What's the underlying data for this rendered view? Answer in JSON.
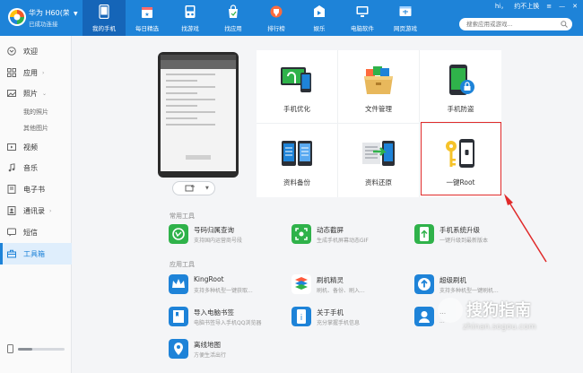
{
  "colors": {
    "accent": "#1e83d8",
    "accent_dark": "#1565b8",
    "highlight": "#e02a2a"
  },
  "device": {
    "name": "华为 H60(荣...",
    "status": "已成功连接"
  },
  "nav": [
    {
      "label": "我的手机",
      "icon": "phone-icon"
    },
    {
      "label": "每日精选",
      "icon": "calendar-icon"
    },
    {
      "label": "找游戏",
      "icon": "gamepad-icon"
    },
    {
      "label": "找应用",
      "icon": "shopping-bag-icon"
    },
    {
      "label": "排行榜",
      "icon": "trophy-icon"
    },
    {
      "label": "娱乐",
      "icon": "music-icon"
    },
    {
      "label": "电脑软件",
      "icon": "monitor-icon"
    },
    {
      "label": "网页游戏",
      "icon": "browser-icon"
    }
  ],
  "window": {
    "user": "hi，",
    "checkin": "约不上换",
    "search_placeholder": "搜索应用或游戏..."
  },
  "sidebar": {
    "items": [
      {
        "label": "欢迎",
        "icon": "welcome-icon"
      },
      {
        "label": "应用",
        "icon": "apps-grid-icon"
      },
      {
        "label": "照片",
        "icon": "photo-icon"
      },
      {
        "label": "视频",
        "icon": "video-icon"
      },
      {
        "label": "音乐",
        "icon": "music-note-icon"
      },
      {
        "label": "电子书",
        "icon": "book-icon"
      },
      {
        "label": "通讯录",
        "icon": "contacts-icon"
      },
      {
        "label": "短信",
        "icon": "sms-icon"
      },
      {
        "label": "工具箱",
        "icon": "toolbox-icon"
      }
    ],
    "photo_sub": [
      "我的照片",
      "其他图片"
    ],
    "storage_fraction": 0.3
  },
  "tiles": [
    {
      "label": "手机优化",
      "icon": "phone-optimize-icon"
    },
    {
      "label": "文件管理",
      "icon": "file-manage-icon"
    },
    {
      "label": "手机防盗",
      "icon": "anti-theft-icon"
    },
    {
      "label": "资料备份",
      "icon": "backup-icon"
    },
    {
      "label": "资料还原",
      "icon": "restore-icon"
    },
    {
      "label": "一键Root",
      "icon": "root-key-icon"
    }
  ],
  "sections": {
    "common": {
      "title": "常用工具",
      "tools": [
        {
          "name": "号码归属查询",
          "desc": "支持国内运营商号段",
          "color": "#2fb24a",
          "icon": "phone-lookup-icon"
        },
        {
          "name": "动态截屏",
          "desc": "生成手机屏幕动态GIF",
          "color": "#2fb24a",
          "icon": "screenshot-icon"
        },
        {
          "name": "手机系统升级",
          "desc": "一键升级到最新版本",
          "color": "#2fb24a",
          "icon": "system-upgrade-icon"
        }
      ]
    },
    "apps": {
      "title": "应用工具",
      "tools": [
        {
          "name": "KingRoot",
          "desc": "支持多种机型一键获取...",
          "color": "#1e83d8",
          "icon": "kingroot-icon"
        },
        {
          "name": "刷机精灵",
          "desc": "刷机、备份、刷入...",
          "color": "#1e83d8",
          "icon": "flash-tool-icon"
        },
        {
          "name": "超级刷机",
          "desc": "支持多种机型一键刷机...",
          "color": "#1e83d8",
          "icon": "super-flash-icon"
        },
        {
          "name": "导入电脑书签",
          "desc": "电脑书签导入手机QQ浏览器",
          "color": "#1e83d8",
          "icon": "bookmark-import-icon"
        },
        {
          "name": "关于手机",
          "desc": "充分掌握手机信息",
          "color": "#1e83d8",
          "icon": "phone-info-icon"
        },
        {
          "name": "...",
          "desc": "...",
          "color": "#1e83d8",
          "icon": "contacts-tool-icon"
        },
        {
          "name": "离线地图",
          "desc": "方便生活出行",
          "color": "#1e83d8",
          "icon": "offline-map-icon"
        }
      ]
    }
  },
  "watermark": {
    "cn": "搜狗指南",
    "en": "zhinan.sogou.com"
  }
}
